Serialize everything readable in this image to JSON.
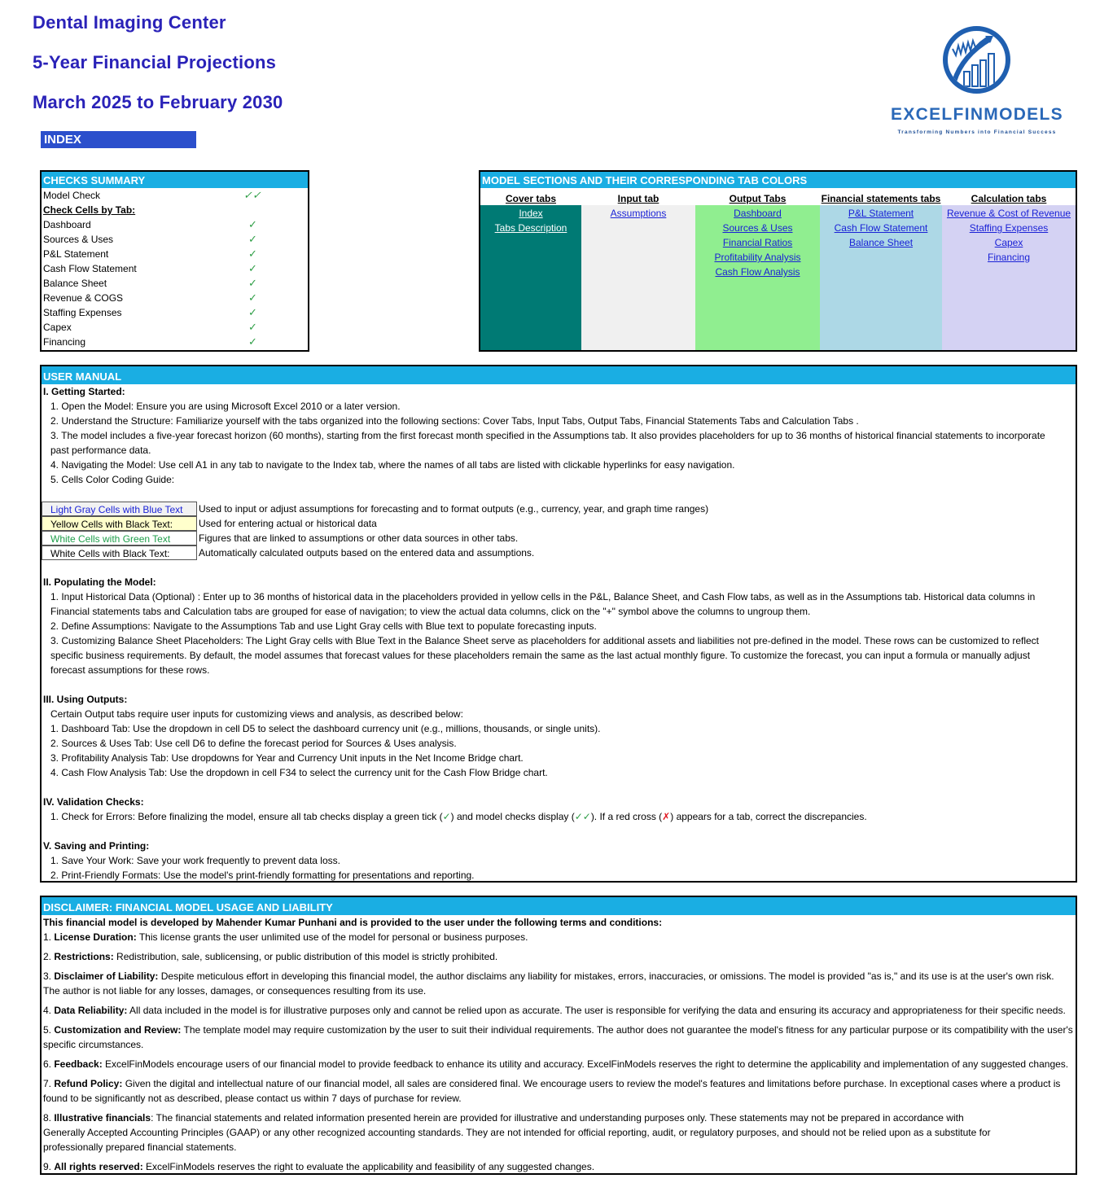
{
  "header": {
    "title_line1": "Dental Imaging Center",
    "title_line2": "5-Year Financial Projections",
    "title_line3": "March 2025 to February 2030",
    "index_button": "INDEX"
  },
  "logo": {
    "brand": "EXCELFINMODELS",
    "tagline": "Transforming Numbers into Financial Success",
    "color": "#2a68b8"
  },
  "checks_summary": {
    "title": "CHECKS  SUMMARY",
    "model_check_label": "Model Check",
    "model_check_status": "✓✓",
    "by_tab_label": "Check Cells by Tab:",
    "tabs": [
      {
        "label": "Dashboard",
        "status": "✓"
      },
      {
        "label": "Sources & Uses",
        "status": "✓"
      },
      {
        "label": "P&L Statement",
        "status": "✓"
      },
      {
        "label": "Cash Flow Statement",
        "status": "✓"
      },
      {
        "label": "Balance Sheet",
        "status": "✓"
      },
      {
        "label": "Revenue & COGS",
        "status": "✓"
      },
      {
        "label": "Staffing Expenses",
        "status": "✓"
      },
      {
        "label": "Capex",
        "status": "✓"
      },
      {
        "label": "Financing",
        "status": "✓"
      }
    ],
    "tick_color": "#2e9e46"
  },
  "model_sections": {
    "title": "MODEL SECTIONS AND THEIR CORRESPONDING TAB COLORS",
    "columns": [
      {
        "header": "Cover tabs",
        "color": "#007a74",
        "links": [
          "Index",
          "Tabs Description"
        ]
      },
      {
        "header": "Input tab",
        "color": "#f0f0f0",
        "links": [
          "Assumptions "
        ]
      },
      {
        "header": "Output Tabs",
        "color": "#90ee90",
        "links": [
          "Dashboard",
          "Sources & Uses",
          "Financial Ratios ",
          "Profitability Analysis",
          "Cash Flow Analysis"
        ]
      },
      {
        "header": "Financial statements tabs",
        "color": "#add8e6",
        "links": [
          "P&L Statement",
          "Cash Flow Statement",
          "Balance Sheet"
        ]
      },
      {
        "header": "Calculation tabs",
        "color": "#d4d2f3",
        "links": [
          "Revenue & Cost of Revenue",
          "Staffing Expenses",
          "Capex ",
          "Financing"
        ]
      }
    ]
  },
  "user_manual": {
    "title": "USER MANUAL",
    "s1_title": "I. Getting Started:",
    "s1": [
      "1. Open the Model: Ensure you are using Microsoft Excel 2010 or a later version.",
      "2. Understand the Structure: Familiarize yourself with the tabs organized into the following sections: Cover Tabs, Input Tabs, Output Tabs, Financial Statements Tabs and Calculation Tabs .",
      "3. The model includes a five-year forecast horizon (60 months), starting from the first forecast month specified in the Assumptions tab. It also provides placeholders for up to 36 months of historical financial statements to incorporate",
      "past performance data.",
      "4. Navigating the Model: Use cell A1 in any tab to navigate to the Index tab, where the names of all tabs are listed with clickable hyperlinks for easy navigation.",
      "5. Cells Color Coding Guide:"
    ],
    "color_guide": [
      {
        "cell": "Light Gray Cells with Blue Text",
        "bg": "#f2f2f2",
        "fg": "#1a22d6",
        "desc": "Used to input or adjust assumptions for forecasting and to format outputs (e.g., currency, year, and graph time ranges)"
      },
      {
        "cell": "Yellow Cells with Black Text:",
        "bg": "#ffffcc",
        "fg": "#000000",
        "desc": "Used for entering actual or historical data"
      },
      {
        "cell": "White Cells with Green Text",
        "bg": "#ffffff",
        "fg": "#1e9e4a",
        "desc": "Figures that are linked to assumptions or other data sources in other tabs."
      },
      {
        "cell": "White Cells with Black Text:",
        "bg": "#ffffff",
        "fg": "#000000",
        "desc": "Automatically calculated outputs based on the entered data and assumptions."
      }
    ],
    "s2_title": "II. Populating the Model:",
    "s2": [
      "1. Input Historical Data (Optional) : Enter up to 36 months of historical data in the placeholders provided in yellow cells in the P&L, Balance Sheet, and Cash Flow tabs, as well as in the Assumptions tab. Historical data columns in",
      "Financial statements tabs and Calculation tabs are grouped for ease of navigation; to view the actual data columns, click on the \"+\" symbol above the columns to ungroup them.",
      "2. Define Assumptions: Navigate to the Assumptions Tab and use Light Gray cells with Blue text to populate forecasting inputs.",
      "3. Customizing Balance Sheet Placeholders: The Light Gray cells with Blue Text in the Balance Sheet serve as placeholders for additional assets and liabilities not pre-defined in the model. These rows can be customized to reflect",
      "specific business requirements. By default, the model assumes that forecast values for these placeholders remain the same as the last actual monthly figure. To customize the forecast, you can input a formula or manually adjust",
      "forecast assumptions for these rows."
    ],
    "s3_title": "III. Using Outputs:",
    "s3": [
      "Certain Output tabs require user inputs for customizing views and analysis, as described below:",
      "1. Dashboard Tab: Use the dropdown in cell D5 to select the dashboard currency unit (e.g., millions, thousands, or single units).",
      "2. Sources & Uses Tab: Use cell D6 to define the forecast period for Sources & Uses analysis.",
      "3. Profitability Analysis Tab: Use dropdowns for Year and Currency Unit inputs in the Net Income Bridge chart.",
      "4. Cash Flow Analysis Tab: Use the dropdown in cell F34 to select the currency unit for the Cash Flow Bridge chart."
    ],
    "s4_title": "IV. Validation Checks:",
    "s4": {
      "part1": "1. Check for Errors:  Before finalizing the model, ensure all tab checks display a green tick (",
      "tick": "✓",
      "part2": ") and model checks display  (",
      "double_tick": "✓✓",
      "part3": "). If a red cross (",
      "cross": "✗",
      "part4": ") appears for a tab, correct the discrepancies."
    },
    "s5_title": "V. Saving and Printing:",
    "s5": [
      "1. Save Your Work: Save your work frequently to prevent data loss.",
      "2. Print-Friendly Formats: Use the model's print-friendly formatting for presentations and reporting."
    ]
  },
  "disclaimer": {
    "title": "DISCLAIMER: FINANCIAL MODEL USAGE AND LIABILITY",
    "intro": "This financial model  is developed by Mahender Kumar Punhani and is provided to the user under the following terms and conditions:",
    "items": [
      {
        "num": "1. ",
        "term": "License Duration:",
        "lines": [
          " This license grants the user unlimited use of the model for personal or business purposes."
        ]
      },
      {
        "num": "2. ",
        "term": "Restrictions:",
        "lines": [
          " Redistribution, sale, sublicensing, or public distribution of this model is strictly prohibited."
        ]
      },
      {
        "num": "3. ",
        "term": "Disclaimer of Liability:",
        "lines": [
          " Despite meticulous effort in developing this financial model, the author disclaims any liability for mistakes, errors, inaccuracies, or omissions. The model is provided \"as is,\" and its use is at the user's own risk.",
          "The author is not liable for  any losses, damages, or consequences resulting from its use."
        ]
      },
      {
        "num": "4. ",
        "term": "Data Reliability:",
        "lines": [
          " All data included in the model is for illustrative purposes only and cannot be relied upon as accurate. The user is  responsible for verifying the data and ensuring its accuracy and appropriateness for their specific needs."
        ]
      },
      {
        "num": "5. ",
        "term": "Customization and Review:",
        "lines": [
          " The template model may require customization by the user to suit their individual requirements. The author does not guarantee the model's fitness for any  particular purpose or its compatibility with the user's",
          "specific circumstances."
        ]
      },
      {
        "num": "6. ",
        "term": "Feedback:",
        "lines": [
          " ExcelFinModels encourage users of our financial model to provide feedback to enhance its utility and accuracy. ExcelFinModels reserves the right to determine the applicability and implementation of any suggested changes."
        ]
      },
      {
        "num": "7. ",
        "term": "Refund Policy:",
        "lines": [
          " Given the digital and intellectual nature of our financial model, all sales are considered final. We encourage users to review the model's features and limitations before purchase. In exceptional cases where a product is",
          "found to be  significantly not as described, please contact us within 7 days of purchase for review."
        ]
      },
      {
        "num": "8. ",
        "term": "Illustrative financials",
        "lines": [
          ": The financial statements and related information presented herein are provided for illustrative and understanding purposes only. These statements may not be prepared in accordance with",
          "Generally Accepted Accounting Principles (GAAP)  or any other  recognized accounting standards. They are not intended for official reporting, audit, or regulatory purposes, and should not be relied upon as a substitute for",
          "professionally prepared financial statements."
        ]
      },
      {
        "num": "9. ",
        "term": "All rights reserved:",
        "lines": [
          " ExcelFinModels reserves the right to evaluate the applicability and feasibility of any suggested changes."
        ]
      }
    ]
  }
}
